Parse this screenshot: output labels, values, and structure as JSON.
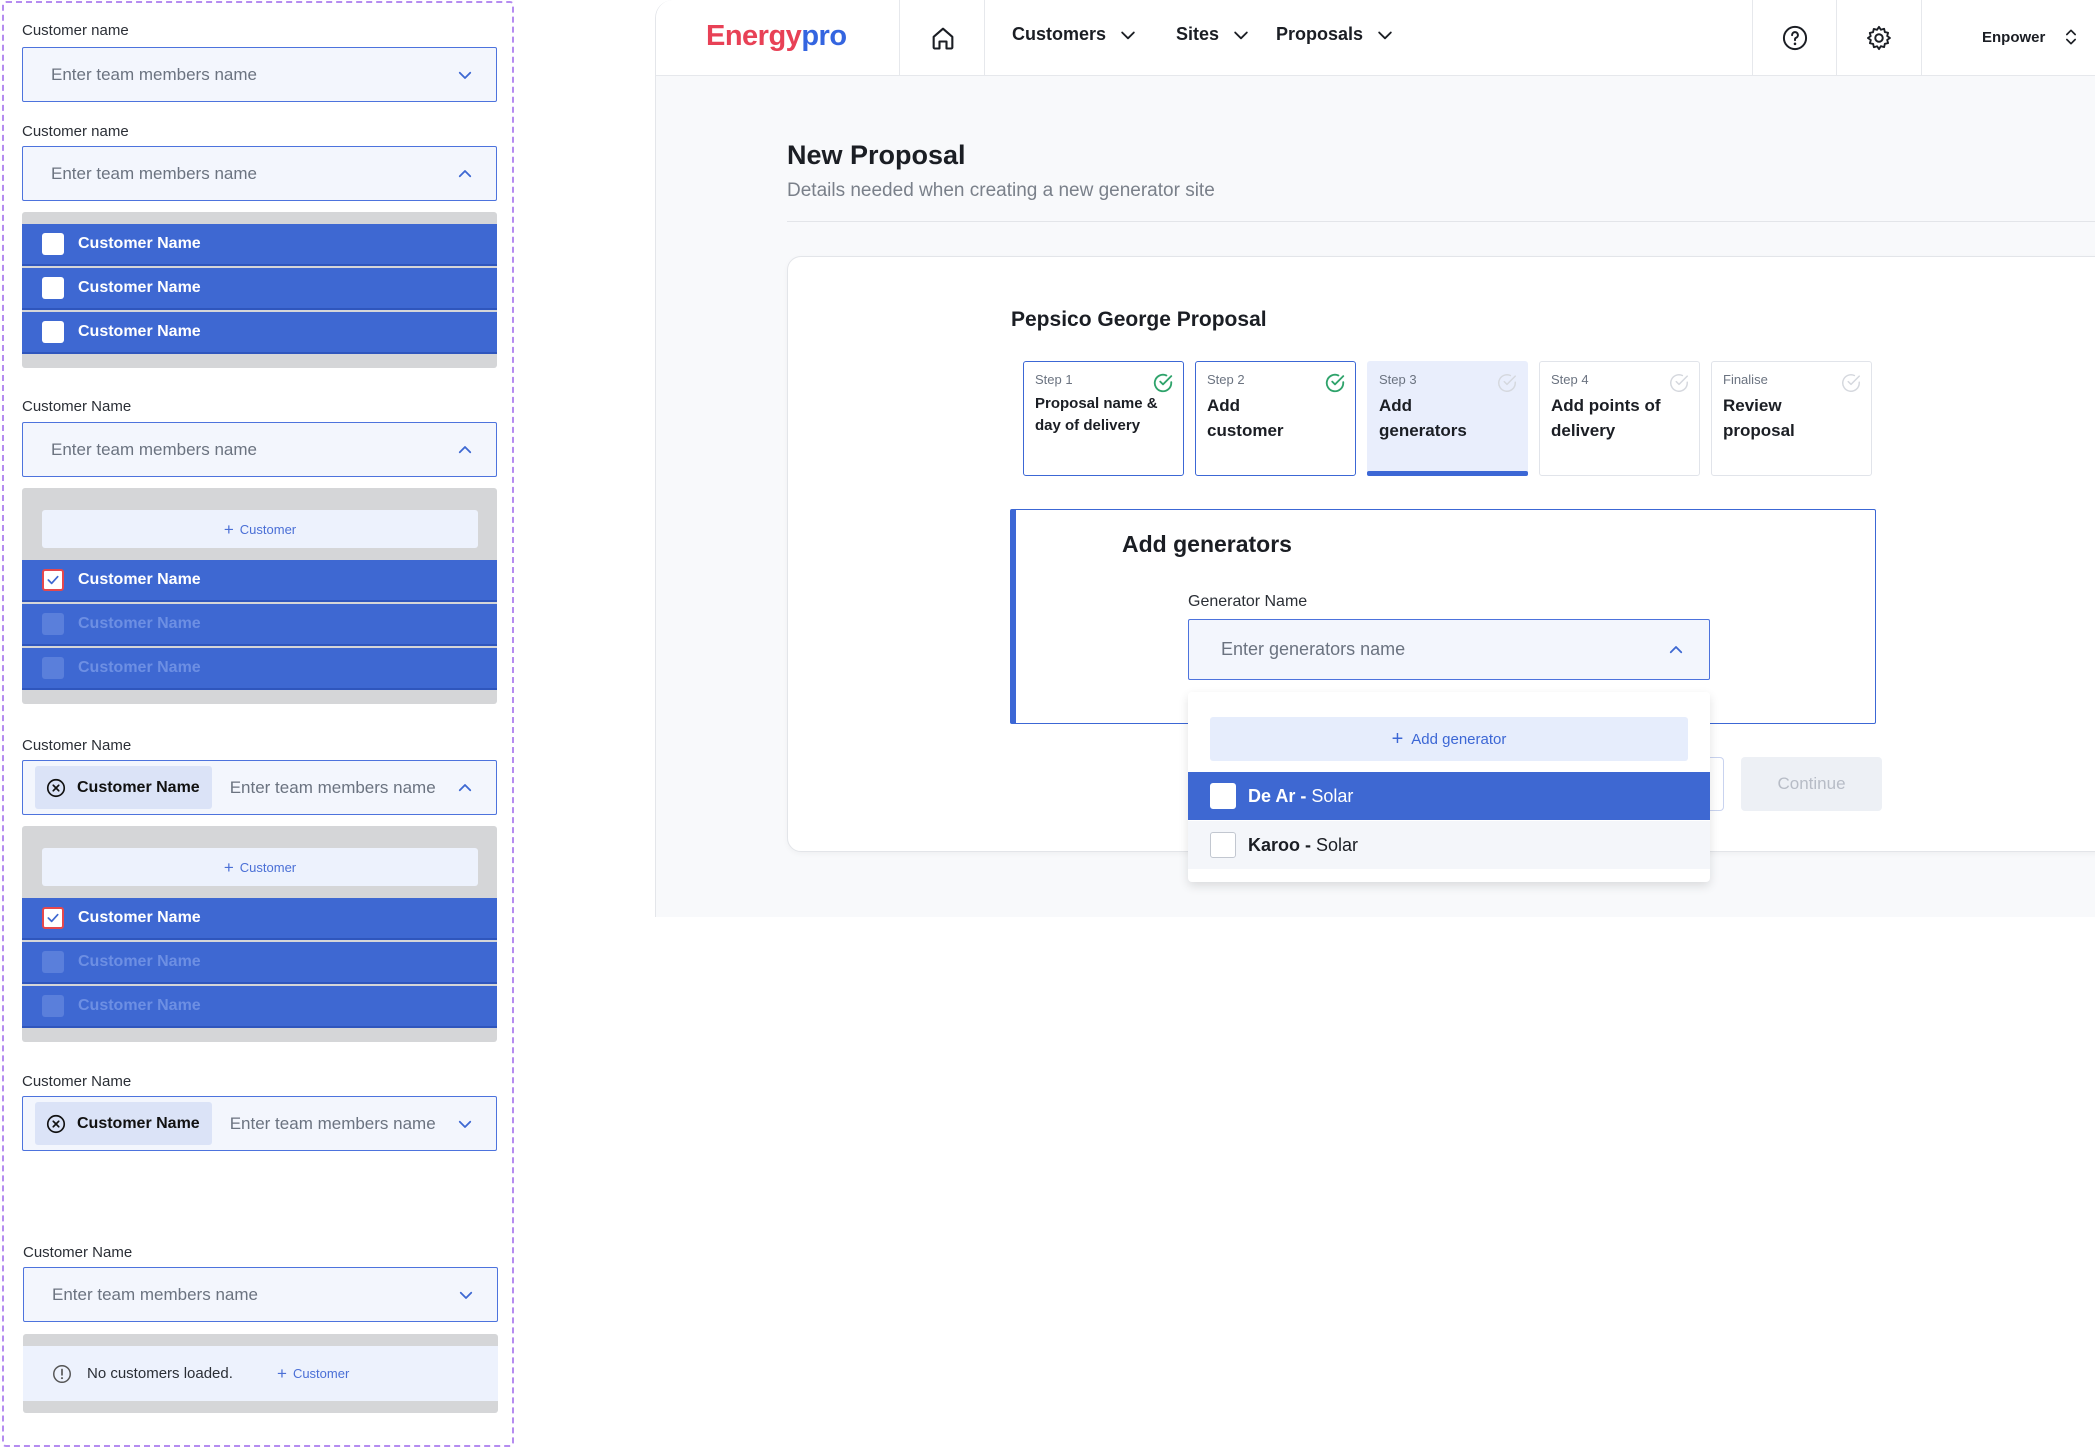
{
  "components": {
    "variant1": {
      "label": "Customer name",
      "placeholder": "Enter team members name"
    },
    "variant2": {
      "label": "Customer name",
      "placeholder": "Enter team members name",
      "options": [
        "Customer Name",
        "Customer Name",
        "Customer Name"
      ]
    },
    "variant3": {
      "label": "Customer Name",
      "placeholder": "Enter team members name",
      "add_label": "Customer",
      "options": [
        "Customer Name",
        "Customer Name",
        "Customer Name"
      ]
    },
    "variant4": {
      "label": "Customer Name",
      "chip": "Customer Name",
      "placeholder": "Enter team members name",
      "add_label": "Customer",
      "options": [
        "Customer Name",
        "Customer Name",
        "Customer Name"
      ]
    },
    "variant5": {
      "label": "Customer Name",
      "chip": "Customer Name",
      "placeholder": "Enter team members name"
    },
    "variant6": {
      "label": "Customer Name",
      "placeholder": "Enter team members name",
      "empty_text": "No customers loaded.",
      "add_label": "Customer"
    }
  },
  "app": {
    "brand_part1": "Energy",
    "brand_part2": "pro",
    "nav": {
      "customers": "Customers",
      "sites": "Sites",
      "proposals": "Proposals"
    },
    "org": "Enpower",
    "page_title": "New Proposal",
    "page_subtitle": "Details needed when creating a new generator site",
    "proposal_title": "Pepsico George Proposal",
    "steps": [
      {
        "num": "Step 1",
        "name": "Proposal name & day of delivery",
        "state": "done"
      },
      {
        "num": "Step 2",
        "name": "Add customer",
        "state": "done"
      },
      {
        "num": "Step 3",
        "name": "Add generators",
        "state": "active"
      },
      {
        "num": "Step 4",
        "name": "Add points of delivery",
        "state": "todo"
      },
      {
        "num": "Finalise",
        "name": "Review proposal",
        "state": "todo"
      }
    ],
    "section_title": "Add generators",
    "field_label": "Generator Name",
    "field_placeholder": "Enter generators name",
    "dropdown": {
      "add_label": "Add generator",
      "options": [
        {
          "name": "De Ar",
          "type": "Solar",
          "selected": true
        },
        {
          "name": "Karoo",
          "type": "Solar",
          "selected": false
        }
      ]
    },
    "continue_label": "Continue",
    "colors": {
      "primary": "#3e68d2",
      "success": "#2fa36b",
      "brand_red": "#e84156"
    }
  }
}
